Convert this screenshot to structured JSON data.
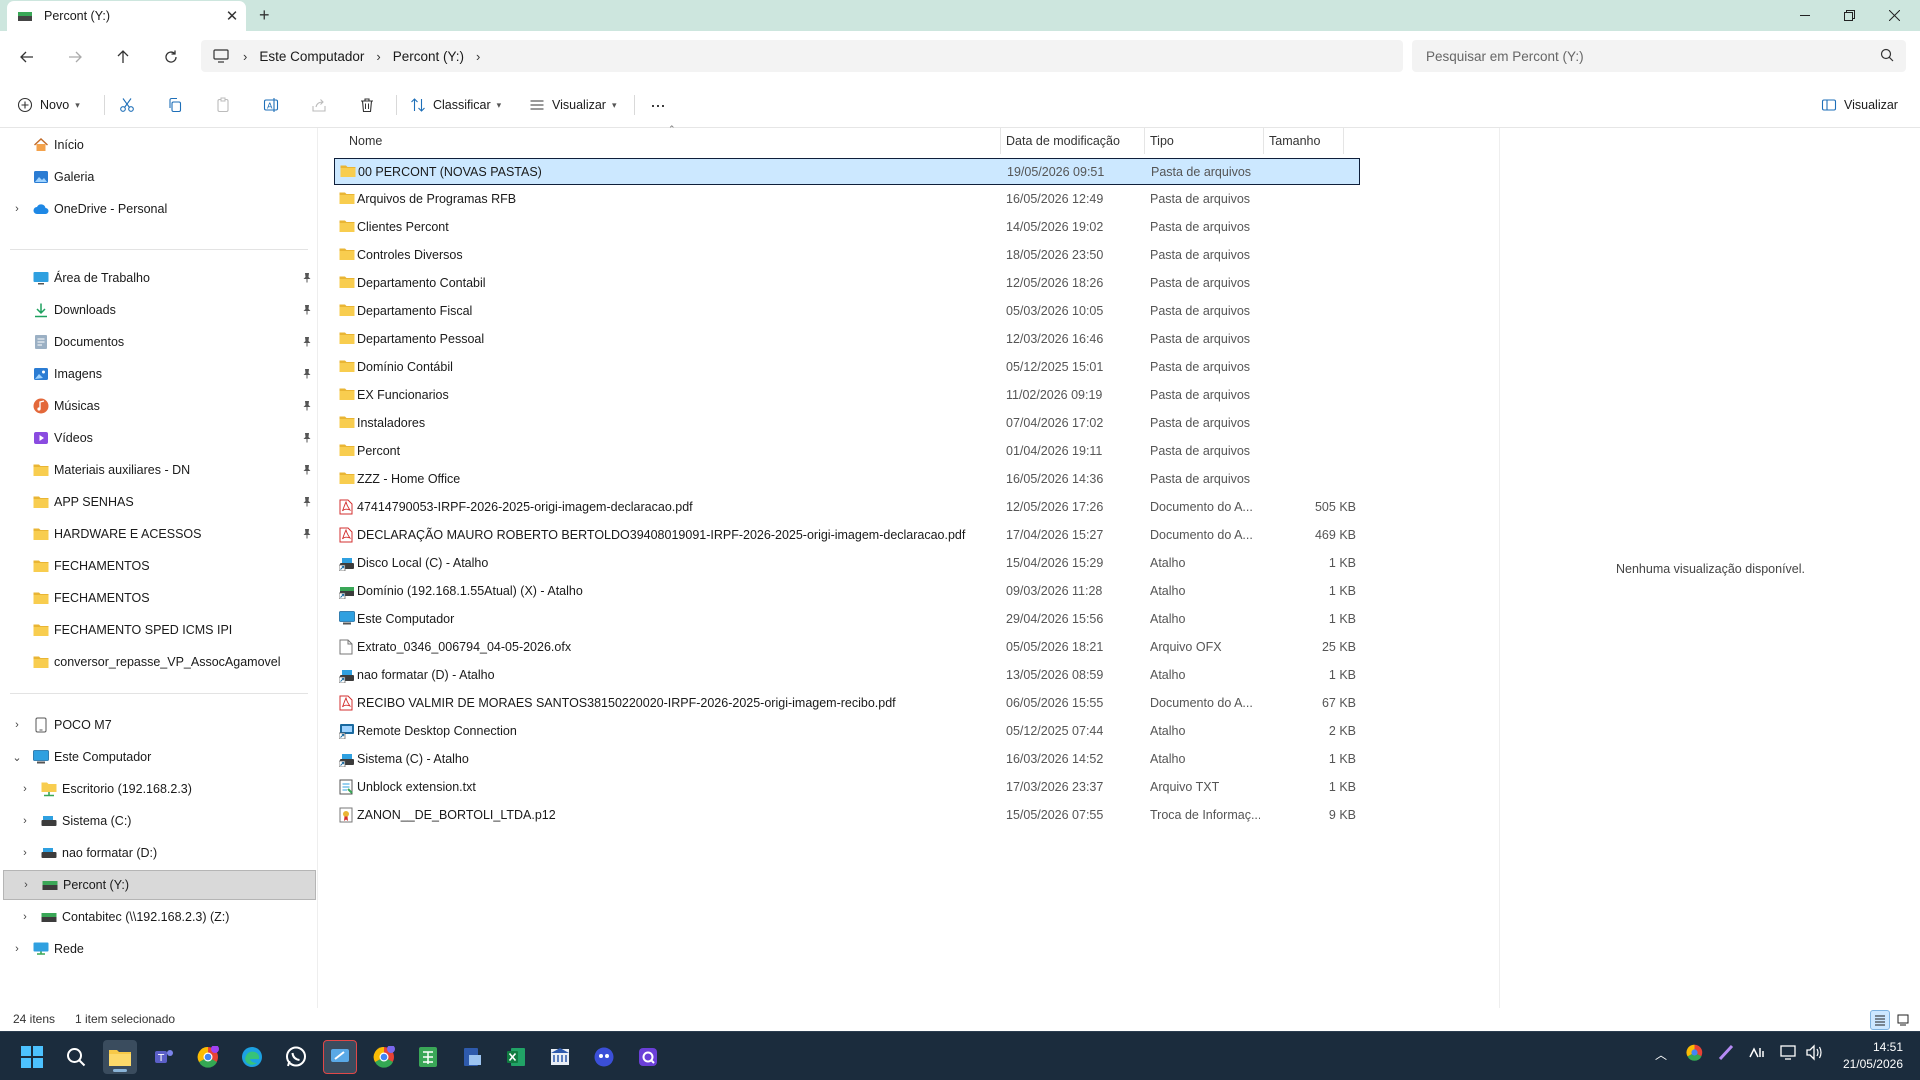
{
  "window": {
    "tab_title": "Percont (Y:)",
    "new_tab": "+"
  },
  "nav": {
    "breadcrumbs": [
      "Este Computador",
      "Percont (Y:)"
    ],
    "search_placeholder": "Pesquisar em Percont (Y:)"
  },
  "toolbar": {
    "new_label": "Novo",
    "sort_label": "Classificar",
    "view_label": "Visualizar",
    "more_label": "···",
    "preview_label": "Visualizar"
  },
  "sidebar": {
    "quick": [
      {
        "label": "Início",
        "icon": "home-icon"
      },
      {
        "label": "Galeria",
        "icon": "gallery-icon"
      },
      {
        "label": "OneDrive - Personal",
        "icon": "cloud-icon",
        "expandable": true
      }
    ],
    "pinned": [
      {
        "label": "Área de Trabalho",
        "icon": "desktop-icon",
        "pinned": true
      },
      {
        "label": "Downloads",
        "icon": "download-icon",
        "pinned": true
      },
      {
        "label": "Documentos",
        "icon": "document-icon",
        "pinned": true
      },
      {
        "label": "Imagens",
        "icon": "images-icon",
        "pinned": true
      },
      {
        "label": "Músicas",
        "icon": "music-icon",
        "pinned": true
      },
      {
        "label": "Vídeos",
        "icon": "video-icon",
        "pinned": true
      },
      {
        "label": "Materiais auxiliares - DN",
        "icon": "folder-icon",
        "pinned": true
      },
      {
        "label": "APP SENHAS",
        "icon": "folder-icon",
        "pinned": true
      },
      {
        "label": "HARDWARE E ACESSOS",
        "icon": "folder-icon",
        "pinned": true
      },
      {
        "label": "FECHAMENTOS",
        "icon": "folder-icon",
        "pinned": false
      },
      {
        "label": "FECHAMENTOS",
        "icon": "folder-icon",
        "pinned": false
      },
      {
        "label": "FECHAMENTO SPED ICMS IPI",
        "icon": "folder-icon",
        "pinned": false
      },
      {
        "label": "conversor_repasse_VP_AssocAgamovel",
        "icon": "folder-icon",
        "pinned": false
      }
    ],
    "devices": [
      {
        "label": "POCO M7",
        "icon": "phone-icon",
        "level": 0,
        "chevron": "›"
      },
      {
        "label": "Este Computador",
        "icon": "computer-icon",
        "level": 0,
        "chevron": "⌄"
      },
      {
        "label": "Escritorio (192.168.2.3)",
        "icon": "network-folder-icon",
        "level": 1,
        "chevron": "›"
      },
      {
        "label": "Sistema (C:)",
        "icon": "drive-icon",
        "level": 1,
        "chevron": "›"
      },
      {
        "label": "nao formatar (D:)",
        "icon": "drive-icon",
        "level": 1,
        "chevron": "›"
      },
      {
        "label": "Percont (Y:)",
        "icon": "network-drive-icon",
        "level": 1,
        "chevron": "›",
        "selected": true
      },
      {
        "label": "Contabitec (\\\\192.168.2.3) (Z:)",
        "icon": "network-drive-icon",
        "level": 1,
        "chevron": "›"
      },
      {
        "label": "Rede",
        "icon": "network-icon",
        "level": 0,
        "chevron": "›"
      }
    ]
  },
  "columns": {
    "name": "Nome",
    "date": "Data de modificação",
    "type": "Tipo",
    "size": "Tamanho"
  },
  "files": [
    {
      "name": "00 PERCONT (NOVAS PASTAS)",
      "date": "19/05/2026 09:51",
      "type": "Pasta de arquivos",
      "size": "",
      "icon": "folder-icon",
      "selected": true
    },
    {
      "name": "Arquivos de Programas RFB",
      "date": "16/05/2026 12:49",
      "type": "Pasta de arquivos",
      "size": "",
      "icon": "folder-icon"
    },
    {
      "name": "Clientes Percont",
      "date": "14/05/2026 19:02",
      "type": "Pasta de arquivos",
      "size": "",
      "icon": "folder-icon"
    },
    {
      "name": "Controles Diversos",
      "date": "18/05/2026 23:50",
      "type": "Pasta de arquivos",
      "size": "",
      "icon": "folder-icon"
    },
    {
      "name": "Departamento Contabil",
      "date": "12/05/2026 18:26",
      "type": "Pasta de arquivos",
      "size": "",
      "icon": "folder-icon"
    },
    {
      "name": "Departamento Fiscal",
      "date": "05/03/2026 10:05",
      "type": "Pasta de arquivos",
      "size": "",
      "icon": "folder-icon"
    },
    {
      "name": "Departamento Pessoal",
      "date": "12/03/2026 16:46",
      "type": "Pasta de arquivos",
      "size": "",
      "icon": "folder-icon"
    },
    {
      "name": "Domínio Contábil",
      "date": "05/12/2025 15:01",
      "type": "Pasta de arquivos",
      "size": "",
      "icon": "folder-icon"
    },
    {
      "name": "EX Funcionarios",
      "date": "11/02/2026 09:19",
      "type": "Pasta de arquivos",
      "size": "",
      "icon": "folder-icon"
    },
    {
      "name": "Instaladores",
      "date": "07/04/2026 17:02",
      "type": "Pasta de arquivos",
      "size": "",
      "icon": "folder-icon"
    },
    {
      "name": "Percont",
      "date": "01/04/2026 19:11",
      "type": "Pasta de arquivos",
      "size": "",
      "icon": "folder-icon"
    },
    {
      "name": "ZZZ - Home Office",
      "date": "16/05/2026 14:36",
      "type": "Pasta de arquivos",
      "size": "",
      "icon": "folder-icon"
    },
    {
      "name": "47414790053-IRPF-2026-2025-origi-imagem-declaracao.pdf",
      "date": "12/05/2026 17:26",
      "type": "Documento do A...",
      "size": "505 KB",
      "icon": "pdf-icon"
    },
    {
      "name": "DECLARAÇÃO MAURO ROBERTO BERTOLDO39408019091-IRPF-2026-2025-origi-imagem-declaracao.pdf",
      "date": "17/04/2026 15:27",
      "type": "Documento do A...",
      "size": "469 KB",
      "icon": "pdf-icon"
    },
    {
      "name": "Disco Local (C) - Atalho",
      "date": "15/04/2026 15:29",
      "type": "Atalho",
      "size": "1 KB",
      "icon": "shortcut-drive-icon"
    },
    {
      "name": "Domínio (192.168.1.55Atual) (X) - Atalho",
      "date": "09/03/2026 11:28",
      "type": "Atalho",
      "size": "1 KB",
      "icon": "shortcut-network-icon"
    },
    {
      "name": "Este Computador",
      "date": "29/04/2026 15:56",
      "type": "Atalho",
      "size": "1 KB",
      "icon": "computer-icon"
    },
    {
      "name": "Extrato_0346_006794_04-05-2026.ofx",
      "date": "05/05/2026 18:21",
      "type": "Arquivo OFX",
      "size": "25 KB",
      "icon": "file-icon"
    },
    {
      "name": "nao formatar (D) - Atalho",
      "date": "13/05/2026 08:59",
      "type": "Atalho",
      "size": "1 KB",
      "icon": "shortcut-drive-icon"
    },
    {
      "name": "RECIBO VALMIR DE MORAES SANTOS38150220020-IRPF-2026-2025-origi-imagem-recibo.pdf",
      "date": "06/05/2026 15:55",
      "type": "Documento do A...",
      "size": "67 KB",
      "icon": "pdf-icon"
    },
    {
      "name": "Remote Desktop Connection",
      "date": "05/12/2025 07:44",
      "type": "Atalho",
      "size": "2 KB",
      "icon": "remote-desktop-icon"
    },
    {
      "name": "Sistema (C) - Atalho",
      "date": "16/03/2026 14:52",
      "type": "Atalho",
      "size": "1 KB",
      "icon": "shortcut-drive-icon"
    },
    {
      "name": "Unblock extension.txt",
      "date": "17/03/2026 23:37",
      "type": "Arquivo TXT",
      "size": "1 KB",
      "icon": "text-file-icon"
    },
    {
      "name": "ZANON__DE_BORTOLI_LTDA.p12",
      "date": "15/05/2026 07:55",
      "type": "Troca de Informaç...",
      "size": "9 KB",
      "icon": "certificate-icon"
    }
  ],
  "preview": {
    "message": "Nenhuma visualização disponível."
  },
  "status": {
    "item_count": "24 itens",
    "selected": "1 item selecionado"
  },
  "clock": {
    "time": "14:51",
    "date": "21/05/2026"
  },
  "colors": {
    "titlebar": "#cde6de",
    "selection": "#cce8ff",
    "folder": "#f7c948",
    "taskbar": "#1b2c3d"
  }
}
